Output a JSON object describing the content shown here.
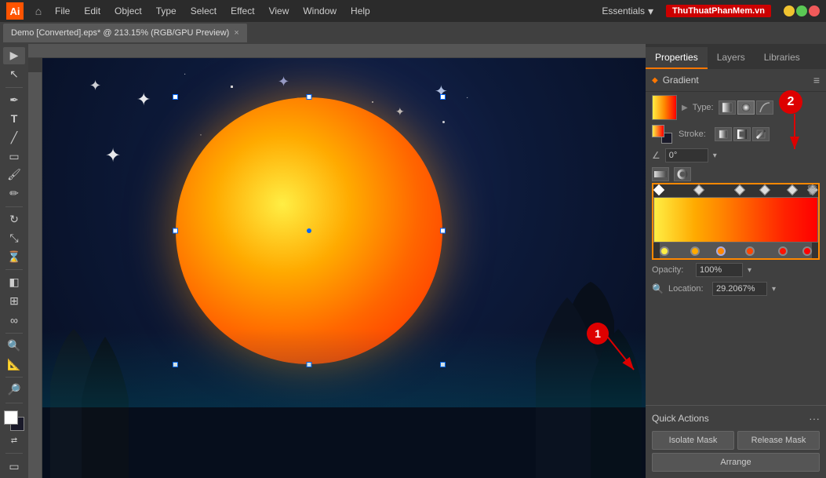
{
  "app": {
    "logo": "Ai",
    "title": "Demo [Converted].eps* @ 213.15% (RGB/GPU Preview)"
  },
  "menubar": {
    "items": [
      "File",
      "Edit",
      "Object",
      "Type",
      "Select",
      "Effect",
      "View",
      "Window",
      "Help"
    ],
    "workspace": "Essentials",
    "watermark": "ThuThuatPhanMem.vn"
  },
  "tab": {
    "label": "Demo [Converted].eps* @ 213.15% (RGB/GPU Preview)",
    "close": "×"
  },
  "panel_tabs": {
    "properties": "Properties",
    "layers": "Layers",
    "libraries": "Libraries"
  },
  "gradient_panel": {
    "title": "Gradient",
    "type_label": "Type:",
    "type_buttons": [
      "linear",
      "radial",
      "freeform"
    ],
    "stroke_label": "Stroke:",
    "stroke_buttons": [
      "s1",
      "s2",
      "s3"
    ],
    "angle_value": "0°",
    "angle_placeholder": "0°",
    "opacity_label": "Opacity:",
    "opacity_value": "100%",
    "location_label": "Location:",
    "location_value": "29.2067%"
  },
  "quick_actions": {
    "title": "Quick Actions",
    "buttons": {
      "isolate_mask": "Isolate Mask",
      "release_mask": "Release Mask",
      "arrange": "Arrange"
    }
  },
  "annotations": {
    "ann1": "1",
    "ann2": "2"
  },
  "gradient_stops": [
    {
      "color": "#ffee44",
      "pos": 0
    },
    {
      "color": "#ffaa00",
      "pos": 25
    },
    {
      "color": "#ff8800",
      "pos": 40
    },
    {
      "color": "#ff5500",
      "pos": 60
    },
    {
      "color": "#ff2200",
      "pos": 80
    },
    {
      "color": "#ff0000",
      "pos": 100
    }
  ]
}
